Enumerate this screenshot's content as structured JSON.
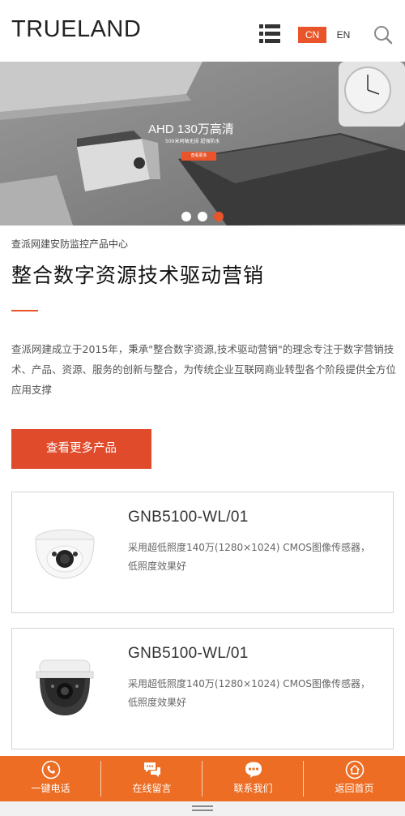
{
  "header": {
    "logo": "TRUELAND",
    "menu_icon": "list-menu-icon",
    "lang_cn": "CN",
    "lang_en": "EN",
    "search_icon": "search-icon"
  },
  "banner": {
    "title": "AHD 130万高清",
    "subtitle": "500米同轴无损 超强防水",
    "button": "查看更多",
    "slide_count": 3,
    "active_slide": 3
  },
  "intro": {
    "subtitle": "查派网建安防监控产品中心",
    "title": "整合数字资源技术驱动营销",
    "description": "查派网建成立于2015年，秉承\"整合数字资源,技术驱动营销\"的理念专注于数字营销技术、产品、资源、服务的创新与整合，为传统企业互联网商业转型各个阶段提供全方位应用支撑",
    "more_button": "查看更多产品"
  },
  "products": [
    {
      "name": "GNB5100-WL/01",
      "desc": "采用超低照度140万(1280×1024) CMOS图像传感器，低照度效果好",
      "icon": "dome-camera-icon"
    },
    {
      "name": "GNB5100-WL/01",
      "desc": "采用超低照度140万(1280×1024) CMOS图像传感器，低照度效果好",
      "icon": "dome-camera-icon"
    }
  ],
  "bottom_bar": [
    {
      "label": "一键电话",
      "icon": "phone-icon"
    },
    {
      "label": "在线留言",
      "icon": "message-icon"
    },
    {
      "label": "联系我们",
      "icon": "chat-icon"
    },
    {
      "label": "返回首页",
      "icon": "home-icon"
    }
  ],
  "colors": {
    "accent": "#e8552a",
    "bottom_bar": "#ec6d23"
  }
}
